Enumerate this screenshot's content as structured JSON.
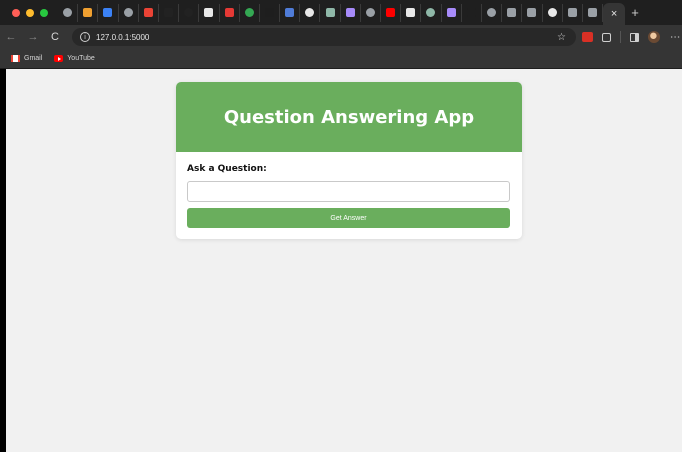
{
  "browser": {
    "tab_close_glyph": "×",
    "new_tab_glyph": "+",
    "back_glyph": "←",
    "forward_glyph": "→",
    "reload_glyph": "C",
    "url": "127.0.0.1:5000",
    "star_glyph": "☆",
    "menu_glyph": "⋮",
    "tab_favicon_colors": [
      "#9aa0a6",
      "#f0a030",
      "#3b82f6",
      "#9aa0a6",
      "#ea4335",
      "#222222",
      "#222222",
      "#e8e8e8",
      "#e53935",
      "#34a853",
      "#1e1e1e",
      "#4f7cd8",
      "#e8e8e8",
      "#8fb8a8",
      "#a78bfa",
      "#9aa0a6",
      "#ff0000",
      "#e8e8e8",
      "#8fb8a8",
      "#a78bfa",
      "#1f1f1f",
      "#9aa0a6",
      "#9aa0a6",
      "#9aa0a6",
      "#e8e8e8",
      "#9aa0a6",
      "#9aa0a6"
    ]
  },
  "bookmarks": [
    {
      "label": "Gmail",
      "icon": "gmail-icon"
    },
    {
      "label": "YouTube",
      "icon": "youtube-icon"
    }
  ],
  "app": {
    "title": "Question Answering App",
    "question_label": "Ask a Question:",
    "question_value": "",
    "submit_label": "Get Answer",
    "accent_color": "#6aae5d",
    "background_color": "#f1f1f1"
  }
}
